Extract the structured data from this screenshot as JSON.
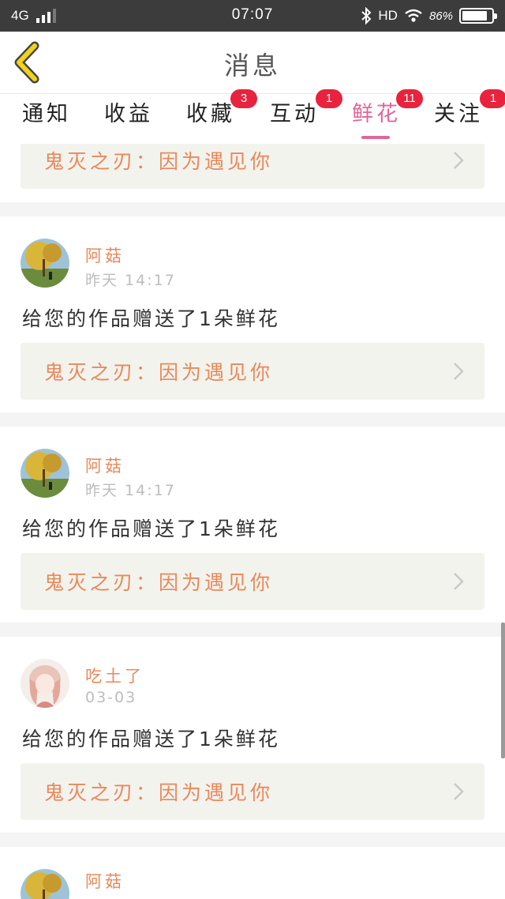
{
  "status_bar": {
    "network": "4G",
    "time": "07:07",
    "hd": "HD",
    "battery": "86%",
    "battery_level": 0.86
  },
  "header": {
    "title": "消息"
  },
  "tabs": [
    {
      "label": "通知",
      "badge": ""
    },
    {
      "label": "收益",
      "badge": ""
    },
    {
      "label": "收藏",
      "badge": "3"
    },
    {
      "label": "互动",
      "badge": "1"
    },
    {
      "label": "鲜花",
      "badge": "11",
      "active": true
    },
    {
      "label": "关注",
      "badge": "1"
    }
  ],
  "feed": {
    "top_partial": {
      "work_title": "鬼灭之刃：因为遇见你"
    },
    "items": [
      {
        "user": "阿菇",
        "time": "昨天 14:17",
        "message": "给您的作品赠送了1朵鲜花",
        "work_title": "鬼灭之刃：因为遇见你",
        "avatar": "avatar-landscape-icon"
      },
      {
        "user": "阿菇",
        "time": "昨天 14:17",
        "message": "给您的作品赠送了1朵鲜花",
        "work_title": "鬼灭之刃：因为遇见你",
        "avatar": "avatar-landscape-icon"
      },
      {
        "user": "吃土了",
        "time": "03-03",
        "message": "给您的作品赠送了1朵鲜花",
        "work_title": "鬼灭之刃：因为遇见你",
        "avatar": "avatar-girl-icon"
      }
    ],
    "bottom_partial": {
      "user": "阿菇"
    }
  },
  "colors": {
    "accent": "#e0669a",
    "badge": "#e8233e",
    "name": "#e8895a",
    "back_icon": "#f2d21a"
  }
}
